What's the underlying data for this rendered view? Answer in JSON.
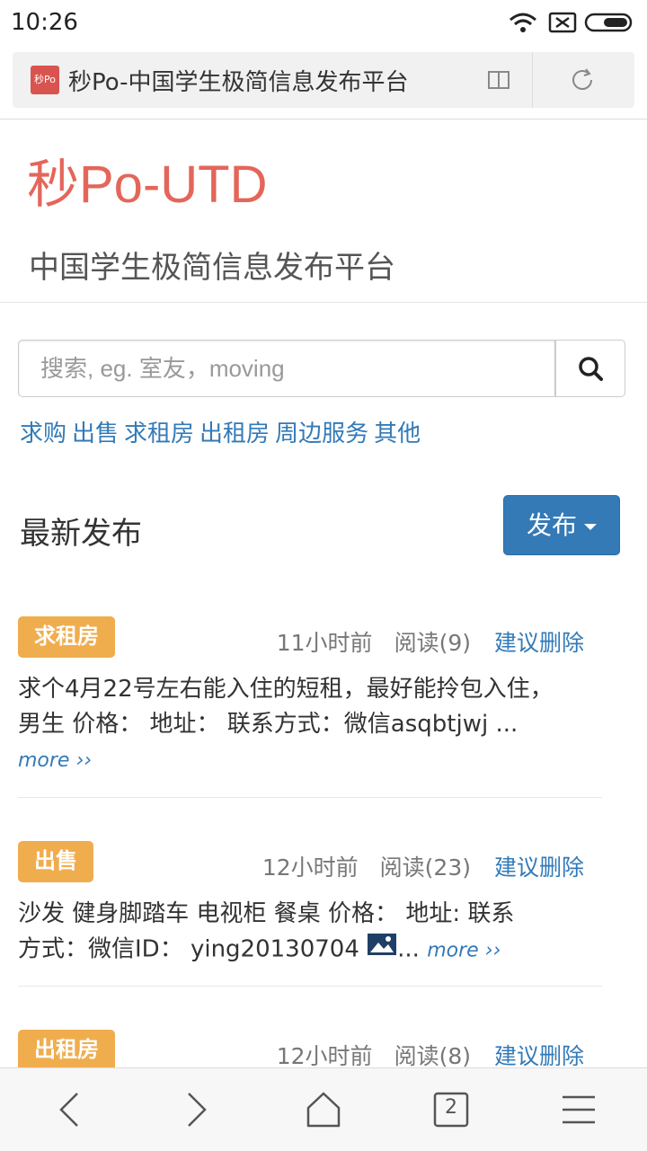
{
  "status_bar": {
    "time": "10:26"
  },
  "browser": {
    "tab_title": "秒Po-中国学生极简信息发布平台",
    "favicon_text": "秒Po"
  },
  "site": {
    "brand": "秒Po-UTD",
    "tagline": "中国学生极简信息发布平台"
  },
  "search": {
    "placeholder": "搜索, eg. 室友，moving"
  },
  "categories": [
    "求购",
    "出售",
    "求租房",
    "出租房",
    "周边服务",
    "其他"
  ],
  "latest": {
    "title": "最新发布",
    "publish_label": "发布"
  },
  "posts": [
    {
      "badge": "求租房",
      "time": "11小时前",
      "reads": "阅读(9)",
      "report": "建议删除",
      "body_line1": "求个4月22号左右能入住的短租，最好能拎包入住，",
      "body_line2": "男生   价格：   地址：   联系方式：微信asqbtjwj    ...",
      "more": "more ››"
    },
    {
      "badge": "出售",
      "time": "12小时前",
      "reads": "阅读(23)",
      "report": "建议删除",
      "body_line1": "沙发 健身脚踏车 电视柜 餐桌    价格：   地址:  联系",
      "body_line2": "方式：微信ID：  ying20130704   ",
      "body_suffix": "...",
      "more": "more ››"
    },
    {
      "badge": "出租房",
      "time": "12小时前",
      "reads": "阅读(8)",
      "report": "建议删除"
    }
  ],
  "bottom_nav": {
    "tab_count": "2"
  }
}
